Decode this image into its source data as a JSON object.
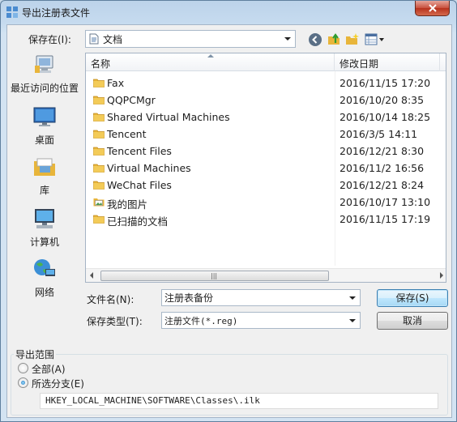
{
  "window": {
    "title": "导出注册表文件"
  },
  "save_in": {
    "label": "保存在(I):",
    "value": "文档"
  },
  "places": [
    {
      "label": "最近访问的位置",
      "icon": "recent-places-icon"
    },
    {
      "label": "桌面",
      "icon": "desktop-icon"
    },
    {
      "label": "库",
      "icon": "libraries-icon"
    },
    {
      "label": "计算机",
      "icon": "computer-icon"
    },
    {
      "label": "网络",
      "icon": "network-icon"
    }
  ],
  "columns": {
    "name": "名称",
    "date": "修改日期"
  },
  "files": [
    {
      "name": "Fax",
      "date": "2016/11/15 17:20",
      "icon": "folder-icon"
    },
    {
      "name": "QQPCMgr",
      "date": "2016/10/20 8:35",
      "icon": "folder-icon"
    },
    {
      "name": "Shared Virtual Machines",
      "date": "2016/10/14 18:25",
      "icon": "folder-icon"
    },
    {
      "name": "Tencent",
      "date": "2016/3/5 14:11",
      "icon": "folder-icon"
    },
    {
      "name": "Tencent Files",
      "date": "2016/12/21 8:30",
      "icon": "folder-icon"
    },
    {
      "name": "Virtual Machines",
      "date": "2016/11/2 16:56",
      "icon": "folder-icon"
    },
    {
      "name": "WeChat Files",
      "date": "2016/12/21 8:24",
      "icon": "folder-icon"
    },
    {
      "name": "我的图片",
      "date": "2016/10/17 13:10",
      "icon": "pictures-folder-icon"
    },
    {
      "name": "已扫描的文档",
      "date": "2016/11/15 17:19",
      "icon": "folder-icon"
    }
  ],
  "filename": {
    "label": "文件名(N):",
    "value": "注册表备份"
  },
  "filetype": {
    "label": "保存类型(T):",
    "value": "注册文件(*.reg)"
  },
  "buttons": {
    "save": "保存(S)",
    "cancel": "取消"
  },
  "export_range": {
    "legend": "导出范围",
    "all_label": "全部(A)",
    "selected_label": "所选分支(E)",
    "selected_value": "HKEY_LOCAL_MACHINE\\SOFTWARE\\Classes\\.ilk",
    "selected_option": "selected"
  },
  "colors": {
    "accent": "#3c7fb1",
    "folder": "#e8b53a",
    "close": "#c8503d"
  }
}
